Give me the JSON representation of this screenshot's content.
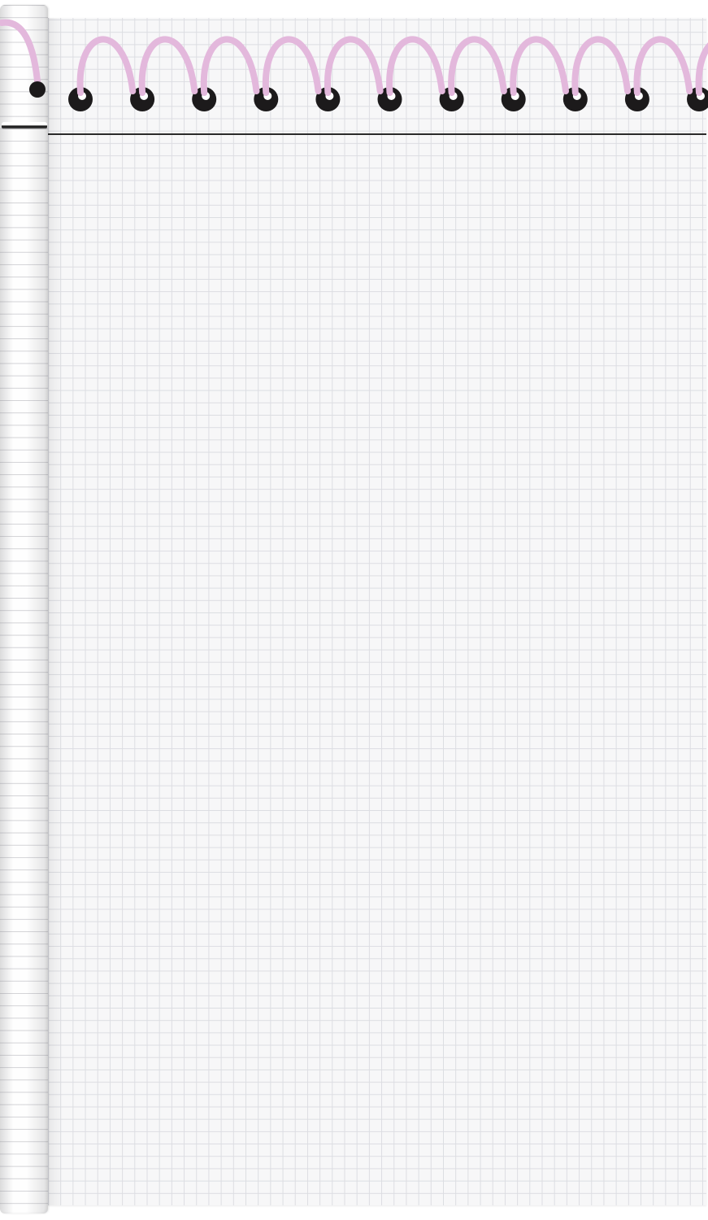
{
  "scene": {
    "subject": "graph-paper-roll",
    "colors": {
      "paper": "#f7f7f8",
      "grid": "#dcdde2",
      "spiral": "#e3b8dc",
      "hole": "#1c1a1b",
      "rule": "#2a2a2a"
    },
    "spiral_rings": 11
  }
}
